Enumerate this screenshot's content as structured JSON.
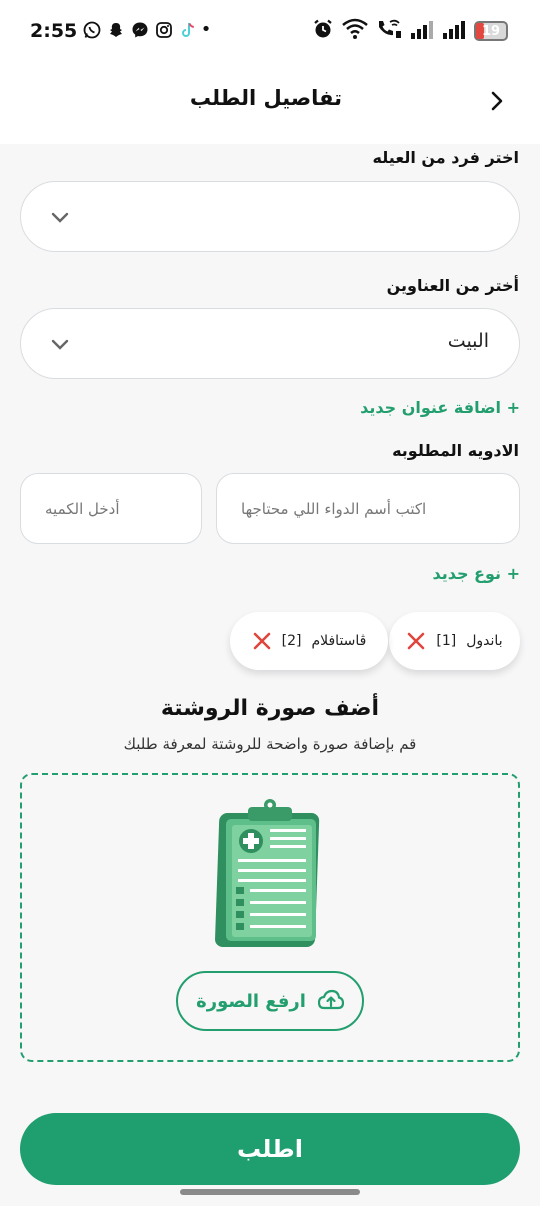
{
  "status_bar": {
    "time": "2:55",
    "battery": "19",
    "notification_icons": [
      "whatsapp-icon",
      "snapchat-icon",
      "messenger-icon",
      "instagram-icon",
      "tiktok-icon",
      "dot-icon"
    ],
    "system_icons": [
      "alarm-icon",
      "wifi-icon",
      "wifi-call-icon",
      "signal-icon",
      "signal-icon",
      "battery-icon"
    ]
  },
  "header": {
    "title": "تفاصيل الطلب"
  },
  "family": {
    "label": "اختر فرد من العيله",
    "value": ""
  },
  "address": {
    "label": "أختر من العناوين",
    "value": "البيت",
    "add_link": "+ اضافة عنوان جديد"
  },
  "medicines": {
    "label": "الادويه المطلوبه",
    "name_placeholder": "اكتب أسم الدواء اللي محتاجها",
    "qty_placeholder": "أدخل الكميه",
    "add_link": "+ نوع جديد",
    "items": [
      {
        "name": "باندول",
        "qty": "[1]"
      },
      {
        "name": "ڤاستافلام",
        "qty": "[2]"
      }
    ]
  },
  "prescription": {
    "title": "أضف صورة الروشتة",
    "subtitle": "قم بإضافة صورة واضحة للروشتة لمعرفة طلبك",
    "upload_label": "ارفع الصورة"
  },
  "submit_label": "اطلب",
  "colors": {
    "accent": "#1f9e6f",
    "remove": "#e0453b"
  }
}
